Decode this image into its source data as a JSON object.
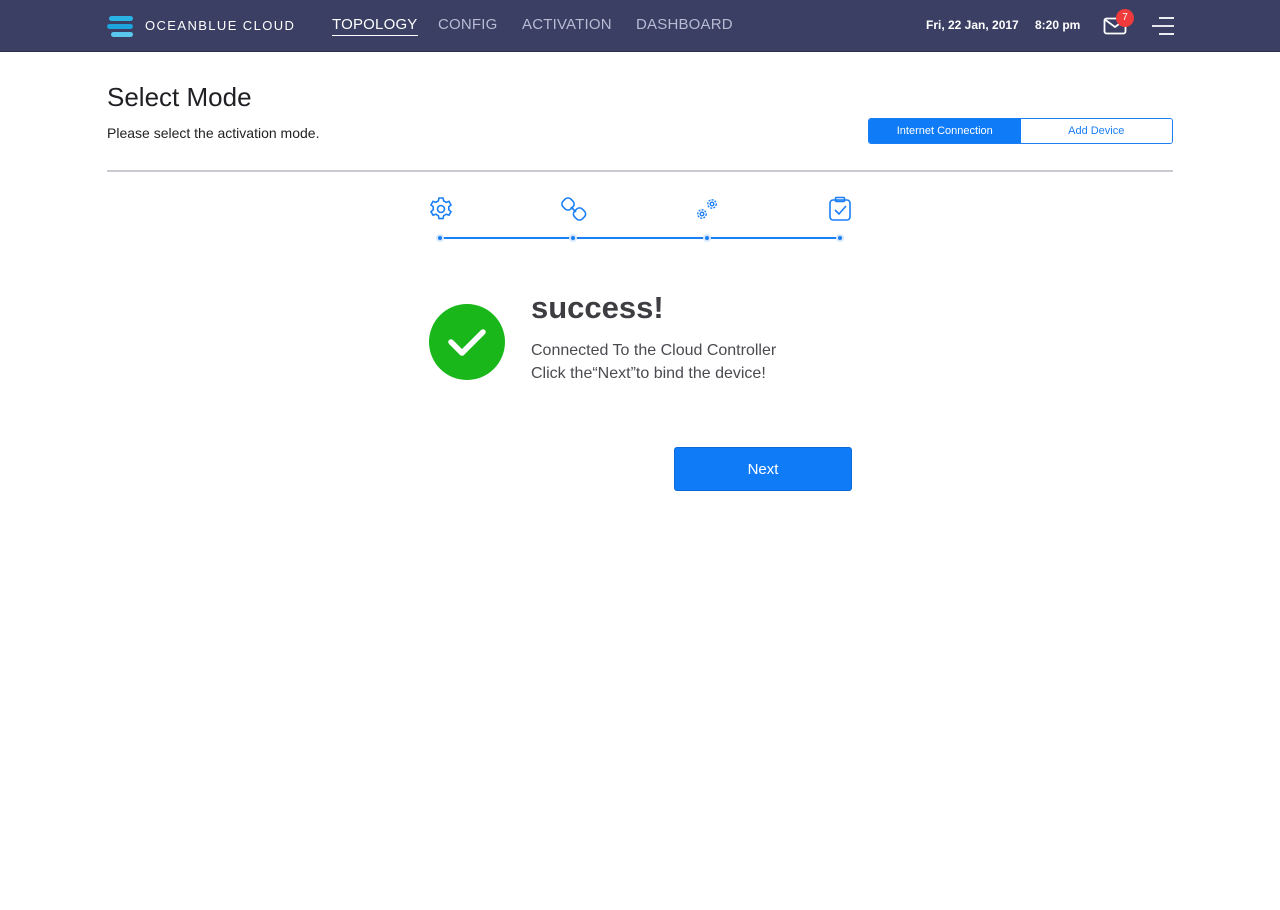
{
  "header": {
    "brand": "OCEANBLUE CLOUD",
    "nav": [
      {
        "label": "TOPOLOGY",
        "active": true
      },
      {
        "label": "CONFIG",
        "active": false
      },
      {
        "label": "ACTIVATION",
        "active": false
      },
      {
        "label": "DASHBOARD",
        "active": false
      }
    ],
    "date": "Fri, 22 Jan, 2017",
    "time": "8:20 pm",
    "mail_count": "7",
    "icons": [
      "logo-icon",
      "mail-icon",
      "menu-icon"
    ]
  },
  "page": {
    "title": "Select Mode",
    "subtitle": "Please select the activation mode.",
    "mode_options": [
      {
        "label": "Internet Connection",
        "selected": true
      },
      {
        "label": "Add Device",
        "selected": false
      }
    ]
  },
  "stepper": {
    "steps": [
      {
        "icon": "gear-icon"
      },
      {
        "icon": "link-icon"
      },
      {
        "icon": "gears-icon"
      },
      {
        "icon": "clipboard-check-icon"
      }
    ],
    "completed": 4
  },
  "result": {
    "title": "success!",
    "line1": "Connected To the Cloud Controller",
    "line2": "Click the“Next”to bind the device!",
    "next_label": "Next"
  },
  "colors": {
    "topbar": "#3a3f63",
    "accent": "#0f7bf7",
    "success": "#19b719"
  }
}
